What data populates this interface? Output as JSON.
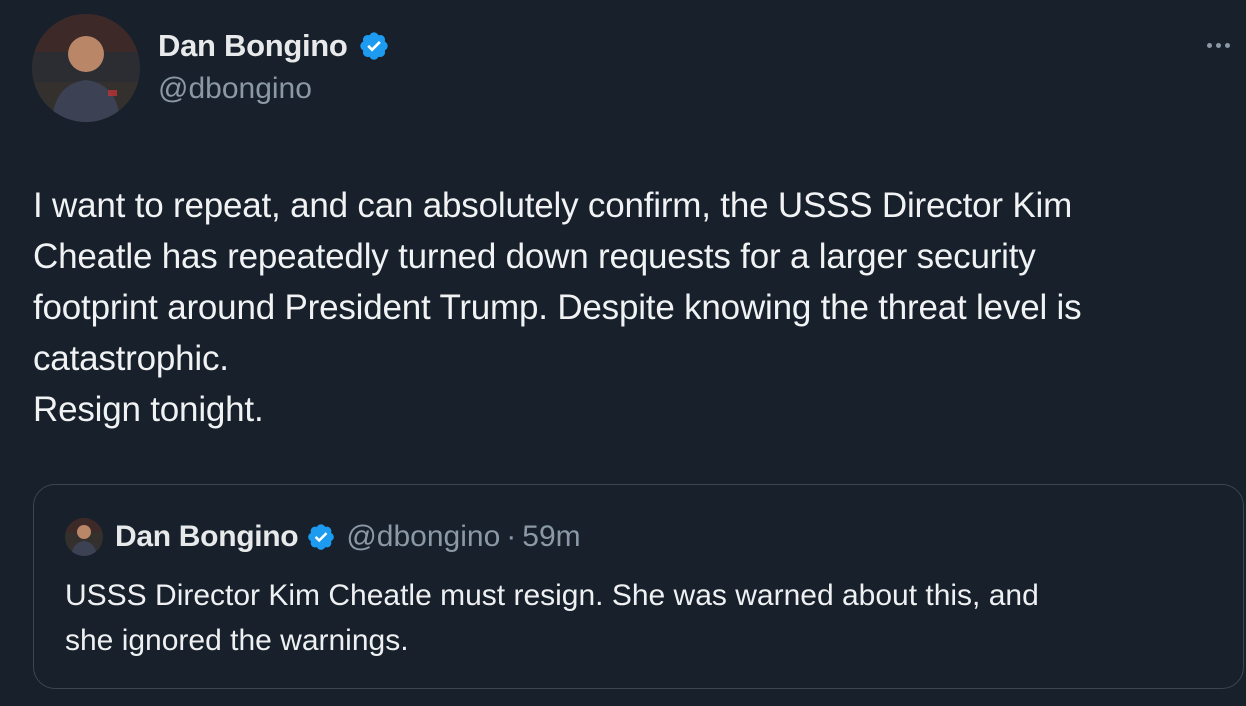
{
  "tweet": {
    "author": {
      "display_name": "Dan Bongino",
      "handle": "@dbongino",
      "verified_icon": "verified-badge-icon",
      "avatar_icon": "avatar-photo"
    },
    "text_lines": [
      "I want to repeat, and can absolutely confirm, the USSS Director Kim",
      "Cheatle has repeatedly turned down requests for a larger security",
      "footprint around President Trump. Despite knowing the threat level is",
      "catastrophic.",
      "Resign tonight."
    ],
    "more_icon": "more-options-icon"
  },
  "quote": {
    "display_name": "Dan Bongino",
    "handle": "@dbongino",
    "separator": "·",
    "time": "59m",
    "text_lines": [
      "USSS Director Kim Cheatle must resign. She was warned about this, and",
      "she ignored the warnings."
    ]
  },
  "colors": {
    "background": "#17202b",
    "verified_blue": "#1d9bf0",
    "secondary_text": "#8b98a5",
    "border": "#3b4650"
  }
}
